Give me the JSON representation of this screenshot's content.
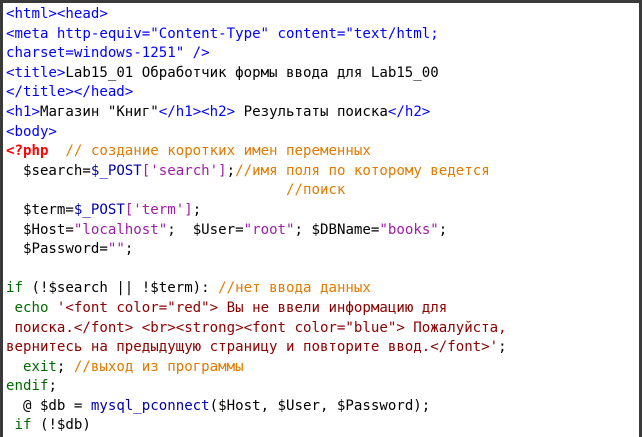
{
  "code_lines": [
    [
      {
        "t": "<html><head>",
        "c": "tag"
      }
    ],
    [
      {
        "t": "<meta http-equiv=\"Content-Type\" content=\"text/html;",
        "c": "tag"
      }
    ],
    [
      {
        "t": "charset=windows-1251\" />",
        "c": "tag"
      }
    ],
    [
      {
        "t": "<title>",
        "c": "tag"
      },
      {
        "t": "Lab15_01 Обработчик формы ввода для Lab15_00",
        "c": "txt"
      }
    ],
    [
      {
        "t": "</title></head>",
        "c": "tag"
      }
    ],
    [
      {
        "t": "<h1>",
        "c": "tag"
      },
      {
        "t": "Магазин \"Книг\"",
        "c": "txt"
      },
      {
        "t": "</h1><h2>",
        "c": "tag"
      },
      {
        "t": " Результаты поиска",
        "c": "txt"
      },
      {
        "t": "</h2>",
        "c": "tag"
      }
    ],
    [
      {
        "t": "<body>",
        "c": "tag"
      }
    ],
    [
      {
        "t": "<?php",
        "c": "php"
      },
      {
        "t": "  // создание коротких имен переменных",
        "c": "cmt"
      }
    ],
    [
      {
        "t": "  $search=",
        "c": "var"
      },
      {
        "t": "$_POST",
        "c": "sup"
      },
      {
        "t": "['search']",
        "c": "str"
      },
      {
        "t": ";",
        "c": "var"
      },
      {
        "t": "//имя поля по которому ведется",
        "c": "cmt"
      }
    ],
    [
      {
        "t": "                                 //поиск",
        "c": "cmt"
      }
    ],
    [
      {
        "t": "  $term=",
        "c": "var"
      },
      {
        "t": "$_POST",
        "c": "sup"
      },
      {
        "t": "['term']",
        "c": "str"
      },
      {
        "t": ";",
        "c": "var"
      }
    ],
    [
      {
        "t": "  $Host=",
        "c": "var"
      },
      {
        "t": "\"localhost\"",
        "c": "str"
      },
      {
        "t": ";  $User=",
        "c": "var"
      },
      {
        "t": "\"root\"",
        "c": "str"
      },
      {
        "t": "; $DBName=",
        "c": "var"
      },
      {
        "t": "\"books\"",
        "c": "str"
      },
      {
        "t": ";",
        "c": "var"
      }
    ],
    [
      {
        "t": "  $Password=",
        "c": "var"
      },
      {
        "t": "\"\"",
        "c": "str"
      },
      {
        "t": ";",
        "c": "var"
      }
    ],
    [
      {
        "t": "",
        "c": "txt"
      }
    ],
    [
      {
        "t": "if",
        "c": "kw"
      },
      {
        "t": " (!$search || !$term): ",
        "c": "var"
      },
      {
        "t": "//нет ввода данных",
        "c": "cmt"
      }
    ],
    [
      {
        "t": " echo",
        "c": "kw"
      },
      {
        "t": " '<font color=\"red\"> Вы не ввели информацию для",
        "c": "echo"
      }
    ],
    [
      {
        "t": " поиска.</font> <br><strong><font color=\"blue\"> Пожалуйста,",
        "c": "echo"
      }
    ],
    [
      {
        "t": "вернитесь на предыдущую страницу и повторите ввод.</font>'",
        "c": "echo"
      },
      {
        "t": ";",
        "c": "var"
      }
    ],
    [
      {
        "t": "  exit",
        "c": "kw"
      },
      {
        "t": "; ",
        "c": "var"
      },
      {
        "t": "//выход из программы",
        "c": "cmt"
      }
    ],
    [
      {
        "t": "endif",
        "c": "kw"
      },
      {
        "t": ";",
        "c": "var"
      }
    ],
    [
      {
        "t": "  @ $db = ",
        "c": "var"
      },
      {
        "t": "mysql_pconnect",
        "c": "fn"
      },
      {
        "t": "($Host, $User, $Password);",
        "c": "var"
      }
    ],
    [
      {
        "t": " if",
        "c": "kw"
      },
      {
        "t": " (!$db)",
        "c": "var"
      }
    ]
  ]
}
